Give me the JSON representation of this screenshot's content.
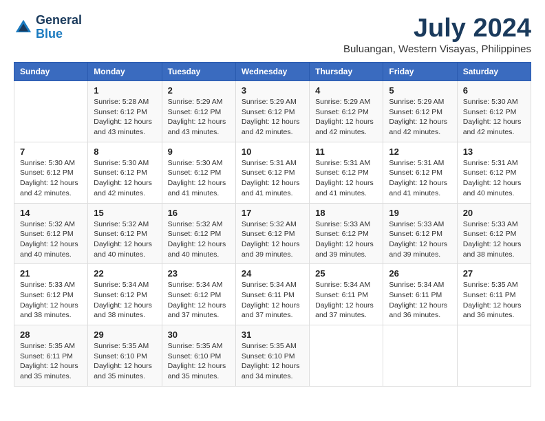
{
  "header": {
    "logo_line1": "General",
    "logo_line2": "Blue",
    "month": "July 2024",
    "location": "Buluangan, Western Visayas, Philippines"
  },
  "weekdays": [
    "Sunday",
    "Monday",
    "Tuesday",
    "Wednesday",
    "Thursday",
    "Friday",
    "Saturday"
  ],
  "weeks": [
    [
      {
        "day": "",
        "info": ""
      },
      {
        "day": "1",
        "info": "Sunrise: 5:28 AM\nSunset: 6:12 PM\nDaylight: 12 hours\nand 43 minutes."
      },
      {
        "day": "2",
        "info": "Sunrise: 5:29 AM\nSunset: 6:12 PM\nDaylight: 12 hours\nand 43 minutes."
      },
      {
        "day": "3",
        "info": "Sunrise: 5:29 AM\nSunset: 6:12 PM\nDaylight: 12 hours\nand 42 minutes."
      },
      {
        "day": "4",
        "info": "Sunrise: 5:29 AM\nSunset: 6:12 PM\nDaylight: 12 hours\nand 42 minutes."
      },
      {
        "day": "5",
        "info": "Sunrise: 5:29 AM\nSunset: 6:12 PM\nDaylight: 12 hours\nand 42 minutes."
      },
      {
        "day": "6",
        "info": "Sunrise: 5:30 AM\nSunset: 6:12 PM\nDaylight: 12 hours\nand 42 minutes."
      }
    ],
    [
      {
        "day": "7",
        "info": "Sunrise: 5:30 AM\nSunset: 6:12 PM\nDaylight: 12 hours\nand 42 minutes."
      },
      {
        "day": "8",
        "info": "Sunrise: 5:30 AM\nSunset: 6:12 PM\nDaylight: 12 hours\nand 42 minutes."
      },
      {
        "day": "9",
        "info": "Sunrise: 5:30 AM\nSunset: 6:12 PM\nDaylight: 12 hours\nand 41 minutes."
      },
      {
        "day": "10",
        "info": "Sunrise: 5:31 AM\nSunset: 6:12 PM\nDaylight: 12 hours\nand 41 minutes."
      },
      {
        "day": "11",
        "info": "Sunrise: 5:31 AM\nSunset: 6:12 PM\nDaylight: 12 hours\nand 41 minutes."
      },
      {
        "day": "12",
        "info": "Sunrise: 5:31 AM\nSunset: 6:12 PM\nDaylight: 12 hours\nand 41 minutes."
      },
      {
        "day": "13",
        "info": "Sunrise: 5:31 AM\nSunset: 6:12 PM\nDaylight: 12 hours\nand 40 minutes."
      }
    ],
    [
      {
        "day": "14",
        "info": "Sunrise: 5:32 AM\nSunset: 6:12 PM\nDaylight: 12 hours\nand 40 minutes."
      },
      {
        "day": "15",
        "info": "Sunrise: 5:32 AM\nSunset: 6:12 PM\nDaylight: 12 hours\nand 40 minutes."
      },
      {
        "day": "16",
        "info": "Sunrise: 5:32 AM\nSunset: 6:12 PM\nDaylight: 12 hours\nand 40 minutes."
      },
      {
        "day": "17",
        "info": "Sunrise: 5:32 AM\nSunset: 6:12 PM\nDaylight: 12 hours\nand 39 minutes."
      },
      {
        "day": "18",
        "info": "Sunrise: 5:33 AM\nSunset: 6:12 PM\nDaylight: 12 hours\nand 39 minutes."
      },
      {
        "day": "19",
        "info": "Sunrise: 5:33 AM\nSunset: 6:12 PM\nDaylight: 12 hours\nand 39 minutes."
      },
      {
        "day": "20",
        "info": "Sunrise: 5:33 AM\nSunset: 6:12 PM\nDaylight: 12 hours\nand 38 minutes."
      }
    ],
    [
      {
        "day": "21",
        "info": "Sunrise: 5:33 AM\nSunset: 6:12 PM\nDaylight: 12 hours\nand 38 minutes."
      },
      {
        "day": "22",
        "info": "Sunrise: 5:34 AM\nSunset: 6:12 PM\nDaylight: 12 hours\nand 38 minutes."
      },
      {
        "day": "23",
        "info": "Sunrise: 5:34 AM\nSunset: 6:12 PM\nDaylight: 12 hours\nand 37 minutes."
      },
      {
        "day": "24",
        "info": "Sunrise: 5:34 AM\nSunset: 6:11 PM\nDaylight: 12 hours\nand 37 minutes."
      },
      {
        "day": "25",
        "info": "Sunrise: 5:34 AM\nSunset: 6:11 PM\nDaylight: 12 hours\nand 37 minutes."
      },
      {
        "day": "26",
        "info": "Sunrise: 5:34 AM\nSunset: 6:11 PM\nDaylight: 12 hours\nand 36 minutes."
      },
      {
        "day": "27",
        "info": "Sunrise: 5:35 AM\nSunset: 6:11 PM\nDaylight: 12 hours\nand 36 minutes."
      }
    ],
    [
      {
        "day": "28",
        "info": "Sunrise: 5:35 AM\nSunset: 6:11 PM\nDaylight: 12 hours\nand 35 minutes."
      },
      {
        "day": "29",
        "info": "Sunrise: 5:35 AM\nSunset: 6:10 PM\nDaylight: 12 hours\nand 35 minutes."
      },
      {
        "day": "30",
        "info": "Sunrise: 5:35 AM\nSunset: 6:10 PM\nDaylight: 12 hours\nand 35 minutes."
      },
      {
        "day": "31",
        "info": "Sunrise: 5:35 AM\nSunset: 6:10 PM\nDaylight: 12 hours\nand 34 minutes."
      },
      {
        "day": "",
        "info": ""
      },
      {
        "day": "",
        "info": ""
      },
      {
        "day": "",
        "info": ""
      }
    ]
  ]
}
